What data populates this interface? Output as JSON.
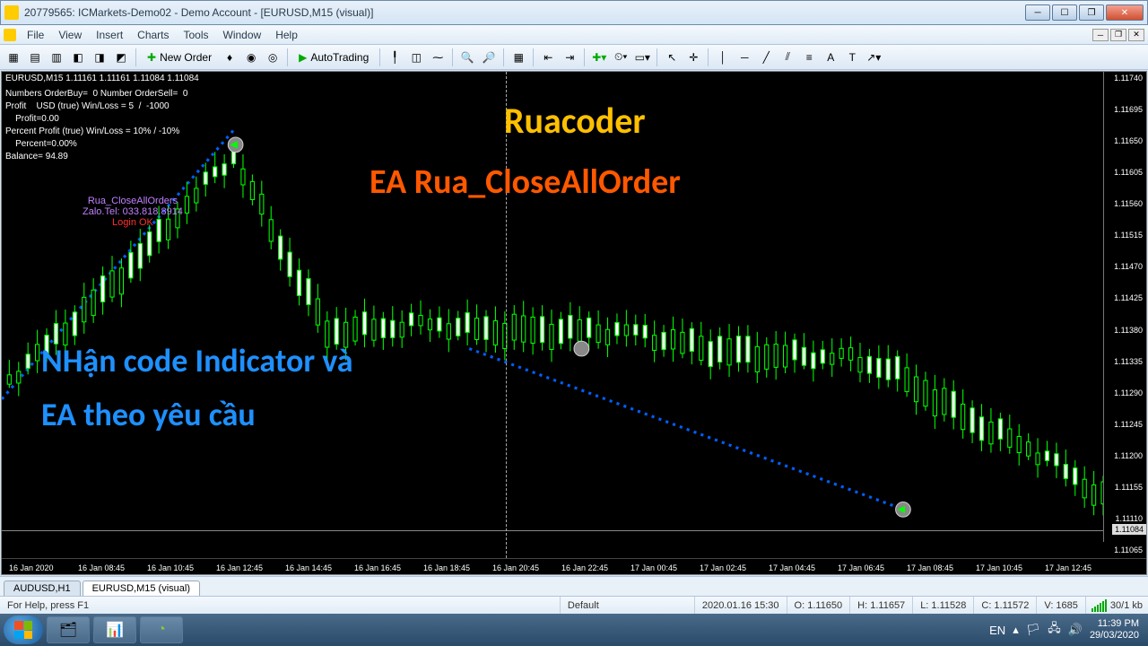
{
  "window": {
    "title": "20779565: ICMarkets-Demo02 - Demo Account - [EURUSD,M15 (visual)]"
  },
  "menu": [
    "File",
    "View",
    "Insert",
    "Charts",
    "Tools",
    "Window",
    "Help"
  ],
  "toolbar": {
    "new_order": "New Order",
    "autotrading": "AutoTrading"
  },
  "chart": {
    "label": "EURUSD,M15  1.11161 1.11161 1.11084 1.11084",
    "info_lines": [
      "Numbers OrderBuy=  0 Number OrderSell=  0",
      "Profit    USD (true) Win/Loss = 5  /  -1000",
      "    Profit=0.00",
      "Percent Profit (true) Win/Loss = 10% / -10%",
      "    Percent=0.00%",
      "Balance= 94.89"
    ],
    "ea": {
      "name": "Rua_CloseAllOrders",
      "contact": "Zalo.Tel: 033.818.8914",
      "status": "Login OK"
    },
    "overlay": {
      "title1": "Ruacoder",
      "title2": "EA Rua_CloseAllOrder",
      "title3": "NHận code Indicator và",
      "title4": "EA theo yêu cầu"
    },
    "price_ticks": [
      "1.11740",
      "1.11695",
      "1.11650",
      "1.11605",
      "1.11560",
      "1.11515",
      "1.11470",
      "1.11425",
      "1.11380",
      "1.11335",
      "1.11290",
      "1.11245",
      "1.11200",
      "1.11155",
      "1.11110",
      "1.11065"
    ],
    "price_current": "1.11084",
    "time_ticks": [
      "16 Jan 2020",
      "16 Jan 08:45",
      "16 Jan 10:45",
      "16 Jan 12:45",
      "16 Jan 14:45",
      "16 Jan 16:45",
      "16 Jan 18:45",
      "16 Jan 20:45",
      "16 Jan 22:45",
      "17 Jan 00:45",
      "17 Jan 02:45",
      "17 Jan 04:45",
      "17 Jan 06:45",
      "17 Jan 08:45",
      "17 Jan 10:45",
      "17 Jan 12:45"
    ]
  },
  "tabs": [
    {
      "label": "AUDUSD,H1",
      "active": false
    },
    {
      "label": "EURUSD,M15 (visual)",
      "active": true
    }
  ],
  "status": {
    "help": "For Help, press F1",
    "profile": "Default",
    "datetime": "2020.01.16 15:30",
    "o": "O: 1.11650",
    "h": "H: 1.11657",
    "l": "L: 1.11528",
    "c": "C: 1.11572",
    "v": "V: 1685",
    "conn": "30/1 kb"
  },
  "taskbar": {
    "lang": "EN",
    "time": "11:39 PM",
    "date": "29/03/2020"
  },
  "chart_data": {
    "type": "candlestick-approx",
    "note": "approximate OHLC reading of visible candles",
    "y_range": [
      1.11065,
      1.1174
    ],
    "trendline": {
      "x1": 0,
      "y1": 1.1128,
      "x2": 0.19,
      "y2": 1.1174
    },
    "trendline2": {
      "x1": 0.4,
      "y1": 1.1139,
      "x2": 0.77,
      "y2": 1.11155
    }
  }
}
